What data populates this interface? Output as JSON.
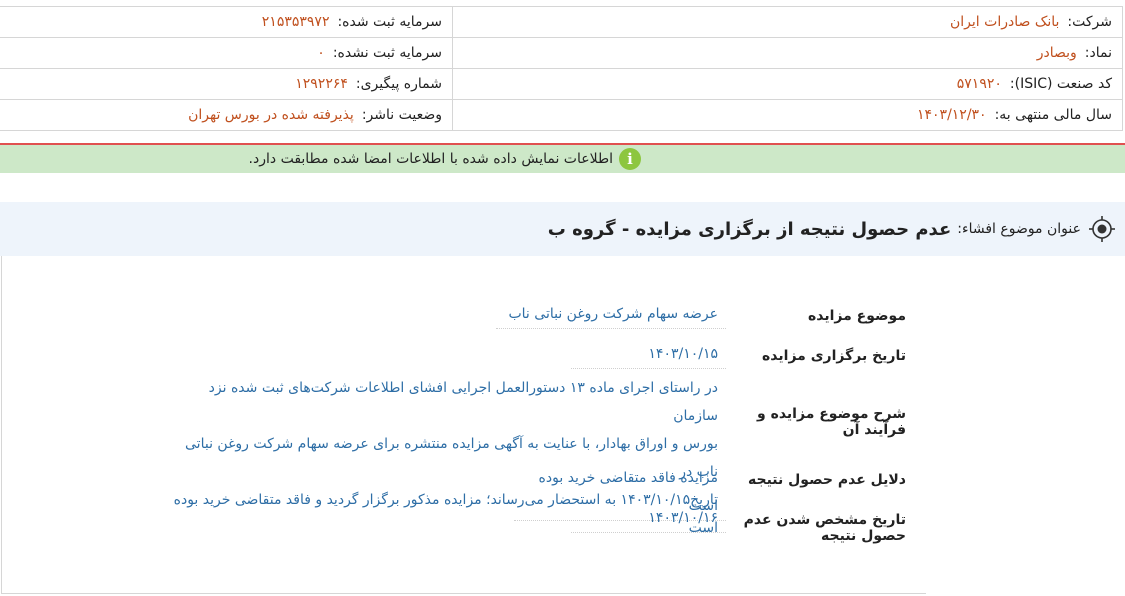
{
  "company_info": {
    "company_label": "شرکت:",
    "company_value": "بانک صادرات ایران",
    "registered_capital_label": "سرمایه ثبت شده:",
    "registered_capital_value": "۲۱۵۳۵۳۹۷۲",
    "symbol_label": "نماد:",
    "symbol_value": "وبصادر",
    "unregistered_capital_label": "سرمایه ثبت نشده:",
    "unregistered_capital_value": "۰",
    "isic_label": "کد صنعت (ISIC):",
    "isic_value": "۵۷۱۹۲۰",
    "tracking_label": "شماره پیگیری:",
    "tracking_value": "۱۲۹۲۲۶۴",
    "fiscal_year_label": "سال مالی منتهی به:",
    "fiscal_year_value": "۱۴۰۳/۱۲/۳۰",
    "publisher_status_label": "وضعیت ناشر:",
    "publisher_status_value": "پذیرفته شده در بورس تهران"
  },
  "verification": {
    "icon": "info-icon",
    "text": "اطلاعات نمایش داده شده با اطلاعات امضا شده مطابقت دارد.",
    "color": "#cde8c8"
  },
  "subject": {
    "icon": "target-icon",
    "label": "عنوان موضوع افشاء:",
    "title": "عدم حصول نتیجه از برگزاری مزایده - گروه ب"
  },
  "details": [
    {
      "label": "موضوع مزایده",
      "value": "عرضه سهام شرکت روغن نباتی ناب"
    },
    {
      "label": "تاریخ برگزاری مزایده",
      "value": "۱۴۰۳/۱۰/۱۵"
    },
    {
      "label": "شرح موضوع مزایده و فرآیند آن",
      "lines": [
        "در راستای اجرای ماده ۱۳ دستورالعمل اجرایی افشای اطلاعات شرکت‌های ثبت شده نزد سازمان",
        "بورس و اوراق بهادار، با عنایت به آگهی مزایده منتشره برای عرضه سهام شرکت روغن نباتی ناب در",
        "تاریخ۱۴۰۳/۱۰/۱۵ به استحضار می‌رساند؛ مزایده مذکور برگزار گردید و فاقد متقاضی خرید بوده است"
      ]
    },
    {
      "label": "دلایل عدم حصول نتیجه",
      "value": "مزایده فاقد متقاضی خرید بوده است"
    },
    {
      "label": "تاریخ مشخص شدن عدم حصول نتیجه",
      "value": "۱۴۰۳/۱۰/۱۶"
    }
  ]
}
